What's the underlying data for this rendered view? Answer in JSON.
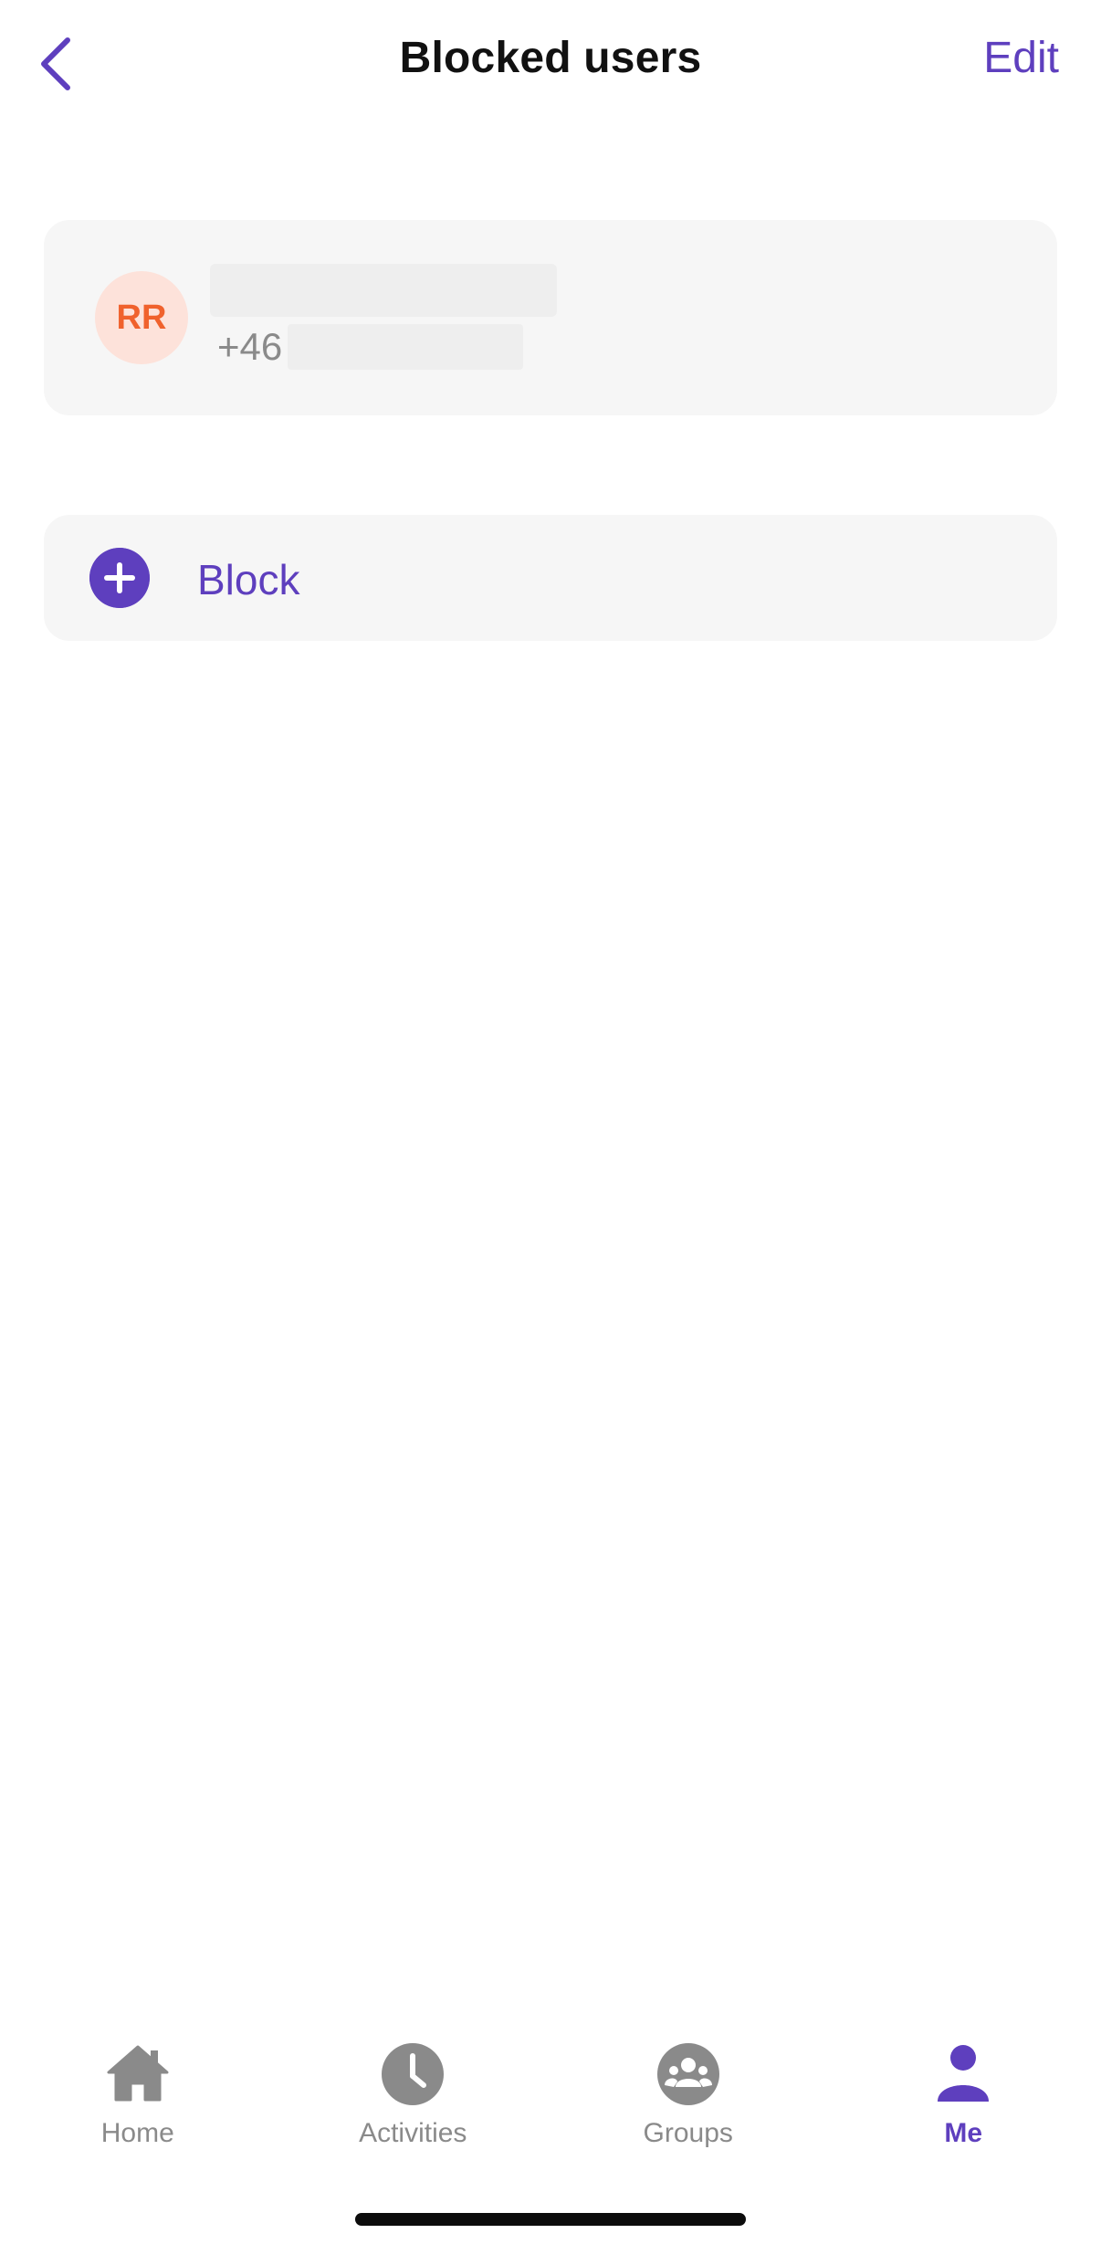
{
  "header": {
    "title": "Blocked users",
    "edit_label": "Edit",
    "back_icon": "chevron-left-icon"
  },
  "blocked_users": [
    {
      "initials": "RR",
      "name": "",
      "phone_prefix": "+46",
      "avatar_bg": "#fde2da",
      "avatar_fg": "#f0622d"
    }
  ],
  "block_action": {
    "label": "Block",
    "icon": "plus-circle-icon"
  },
  "tabbar": {
    "tabs": [
      {
        "label": "Home",
        "icon": "home-icon",
        "active": false
      },
      {
        "label": "Activities",
        "icon": "clock-icon",
        "active": false
      },
      {
        "label": "Groups",
        "icon": "groups-icon",
        "active": false
      },
      {
        "label": "Me",
        "icon": "person-icon",
        "active": true
      }
    ]
  },
  "colors": {
    "accent": "#5e3fbe",
    "muted": "#8a8a8a",
    "card_bg": "#f6f6f6"
  }
}
